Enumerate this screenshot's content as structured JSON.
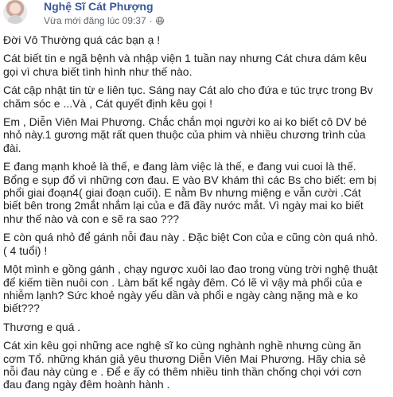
{
  "header": {
    "author": "Nghệ Sĩ Cát Phượng",
    "timestamp": "Vừa mới đăng lúc 09:37",
    "separator": "·",
    "privacy_icon": "globe-icon"
  },
  "paragraphs": [
    [
      "Đời Vô Thường quá các bạn ạ !"
    ],
    [
      "Cát biết tin e ngã bệnh và nhập viện 1 tuần nay nhưng Cát chưa dám kêu",
      "gọi vì chưa biết tình hình như thế nào."
    ],
    [
      "Cát cập nhật tin từ e liên tục. Sáng nay Cát alo cho đứa e túc trực trong Bv",
      "chăm sóc e ...Và , Cát quyết định kêu gọi !"
    ],
    [
      "Em , Diễn Viên Mai Phương. Chắc chắn mọi người ko ai ko biết cô DV bé",
      "nhỏ này.1 gương mặt rất quen thuộc của phim và nhiều chương trình của",
      "đài."
    ],
    [
      "E đang mạnh khoẻ là thế, e đang làm việc là thế, e đang vui cuoi là thế.",
      "Bổng e sụp đổ vì những cơn đau. E vào BV khám thì các Bs cho biết: em bị",
      "phổi giai đoạn4( giai đoạn cuối). E nằm Bv nhưng miệng e vẫn cười .Cát",
      "biết bên trong 2mắt nhắm lại của e đã đầy nước mắt. Vì ngày mai ko biết",
      "như thế nào và con e sẽ ra sao ???"
    ],
    [
      "E còn quá nhỏ để gánh nỗi đau này . Đặc biệt Con của e cũng còn quá nhỏ.",
      "( 4 tuổi) !"
    ],
    [
      "Một mình e gồng gánh , chạy ngược xuôi lao đao trong vùng trời nghệ thuật",
      "để kiếm tiền nuôi con . Làm bất kể ngày đêm. Có lẽ vì vậy mà phổi của e",
      "nhiễm lạnh? Sức khoẻ ngày yếu dần và phổi e ngày càng nặng mà e ko",
      "biết???"
    ],
    [
      "Thương e quá ."
    ],
    [
      "Cát xin kêu gọi những ace nghệ sĩ ko cùng nghành nghề nhưng cùng ăn",
      "cơm Tổ. những khán giả yêu thương Diễn Viên Mai Phương. Hãy chia sẻ",
      "nỗi đau này cùng e . Để e ấy có thêm nhiều tinh thần chống chọi với cơn",
      "đau đang ngày đêm hoành hành ."
    ]
  ]
}
